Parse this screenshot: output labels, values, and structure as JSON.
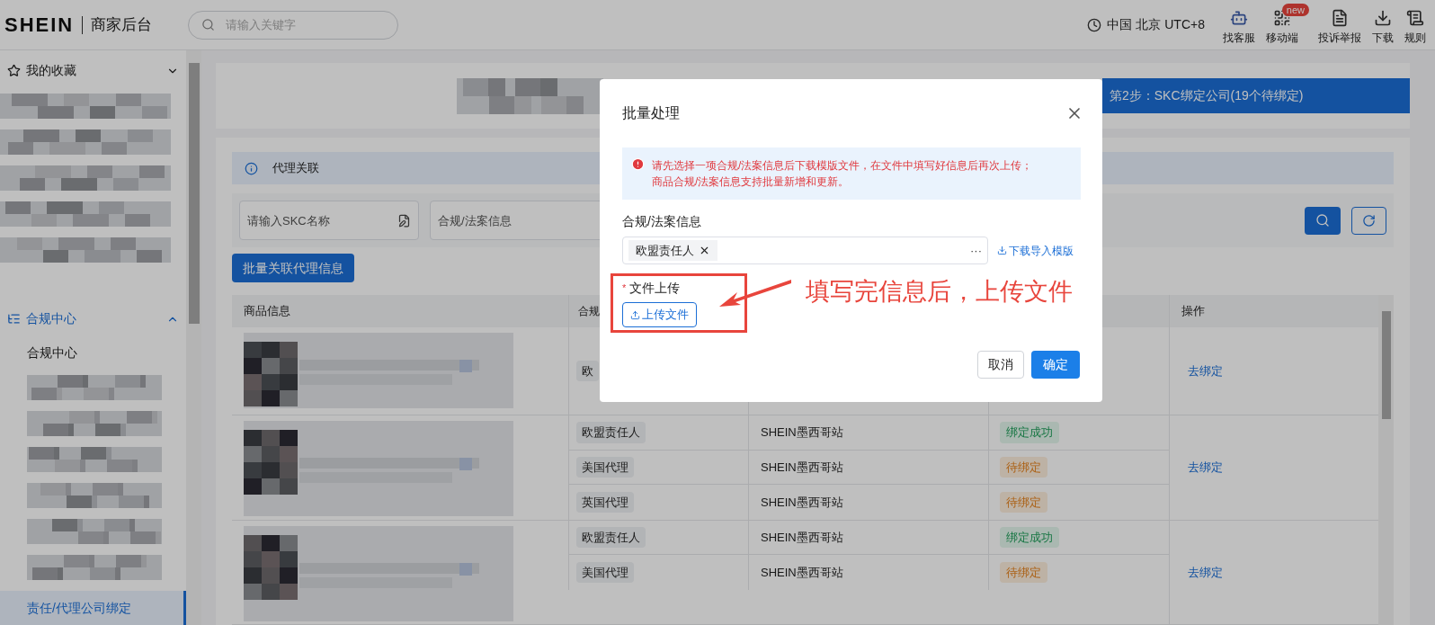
{
  "header": {
    "logo": "SHEIN",
    "title": "商家后台",
    "search": {
      "placeholder": "请输入关键字"
    },
    "timezone": "中国 北京 UTC+8",
    "tools": [
      {
        "kind": "service",
        "label": "找客服"
      },
      {
        "kind": "mobile",
        "label": "移动端",
        "badge": "new"
      },
      {
        "kind": "report",
        "label": "投诉举报"
      },
      {
        "kind": "download",
        "label": "下载"
      },
      {
        "kind": "rules",
        "label": "规则"
      }
    ]
  },
  "sidebar": {
    "items": [
      {
        "kind": "group",
        "label": "我的收藏",
        "active": false
      },
      {
        "kind": "blurred"
      },
      {
        "kind": "blurred"
      },
      {
        "kind": "blurred"
      },
      {
        "kind": "blurred"
      },
      {
        "kind": "blurred"
      },
      {
        "kind": "group",
        "label": "合规中心",
        "active": true
      },
      {
        "kind": "link",
        "label": "合规中心",
        "selected": false
      },
      {
        "kind": "blurred"
      },
      {
        "kind": "blurred"
      },
      {
        "kind": "blurred"
      },
      {
        "kind": "blurred"
      },
      {
        "kind": "blurred"
      },
      {
        "kind": "blurred"
      },
      {
        "kind": "link",
        "label": "责任/代理公司绑定",
        "selected": true
      }
    ]
  },
  "steps": {
    "current": "第2步：SKC绑定公司(19个待绑定)"
  },
  "info_bar": {
    "text": "代理关联"
  },
  "filters": {
    "skc": {
      "placeholder": "请输入SKC名称"
    },
    "compliance": {
      "placeholder": "合规/法案信息"
    }
  },
  "batch_button": "批量关联代理信息",
  "table": {
    "headers": {
      "product": "商品信息",
      "compliance": "合规",
      "action": "操作"
    },
    "groups": [
      {
        "action": "去绑定",
        "rows": [
          {
            "tag": "欧"
          }
        ]
      },
      {
        "action": "去绑定",
        "rows": [
          {
            "tag": "欧盟责任人",
            "site": "SHEIN墨西哥站",
            "status": {
              "label": "绑定成功",
              "kind": "success"
            }
          },
          {
            "tag": "美国代理",
            "site": "SHEIN墨西哥站",
            "status": {
              "label": "待绑定",
              "kind": "pending"
            }
          },
          {
            "tag": "英国代理",
            "site": "SHEIN墨西哥站",
            "status": {
              "label": "待绑定",
              "kind": "pending"
            }
          }
        ]
      },
      {
        "action": "去绑定",
        "rows": [
          {
            "tag": "欧盟责任人",
            "site": "SHEIN墨西哥站",
            "status": {
              "label": "绑定成功",
              "kind": "success"
            }
          },
          {
            "tag": "美国代理",
            "site": "SHEIN墨西哥站",
            "status": {
              "label": "待绑定",
              "kind": "pending"
            }
          }
        ]
      }
    ]
  },
  "modal": {
    "title": "批量处理",
    "alert": [
      "请先选择一项合规/法案信息后下载模版文件，在文件中填写好信息后再次上传；",
      "商品合规/法案信息支持批量新增和更新。"
    ],
    "field_label": "合规/法案信息",
    "selected_tag": "欧盟责任人",
    "more": "···",
    "download_link": "下载导入模版",
    "upload_label": "文件上传",
    "required_mark": "*",
    "upload_button": "上传文件",
    "cancel": "取消",
    "confirm": "确定"
  },
  "annotation": {
    "text": "填写完信息后，上传文件"
  }
}
